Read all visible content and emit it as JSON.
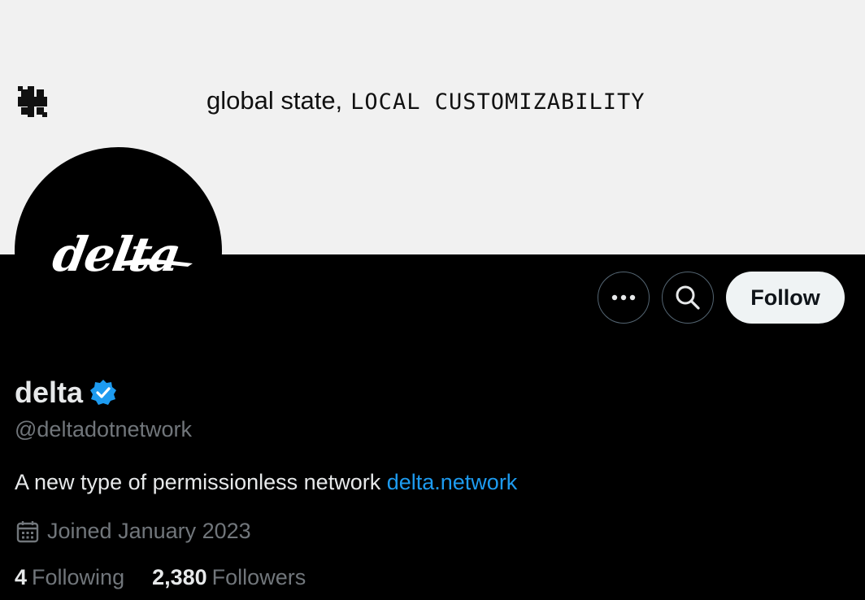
{
  "banner": {
    "tagline_regular": "global state,",
    "tagline_mono": "LOCAL CUSTOMIZABILITY",
    "logo_icon": "asterisk-logo-icon"
  },
  "avatar": {
    "wordmark": "delta"
  },
  "actions": {
    "more_icon": "more-horizontal-icon",
    "search_icon": "search-icon",
    "follow_label": "Follow"
  },
  "profile": {
    "name": "delta",
    "verified_icon": "verified-badge-icon",
    "handle": "@deltadotnetwork",
    "bio_text": "A new type of permissionless network ",
    "bio_link": "delta.network",
    "joined_icon": "calendar-icon",
    "joined": "Joined January 2023",
    "following_count": "4",
    "following_label": "Following",
    "followers_count": "2,380",
    "followers_label": "Followers"
  },
  "colors": {
    "background": "#000000",
    "banner": "#f1f1f1",
    "link": "#1d9bf0",
    "verified": "#1d9bf0",
    "secondary_text": "#71767b",
    "follow_button": "#eff3f4"
  }
}
